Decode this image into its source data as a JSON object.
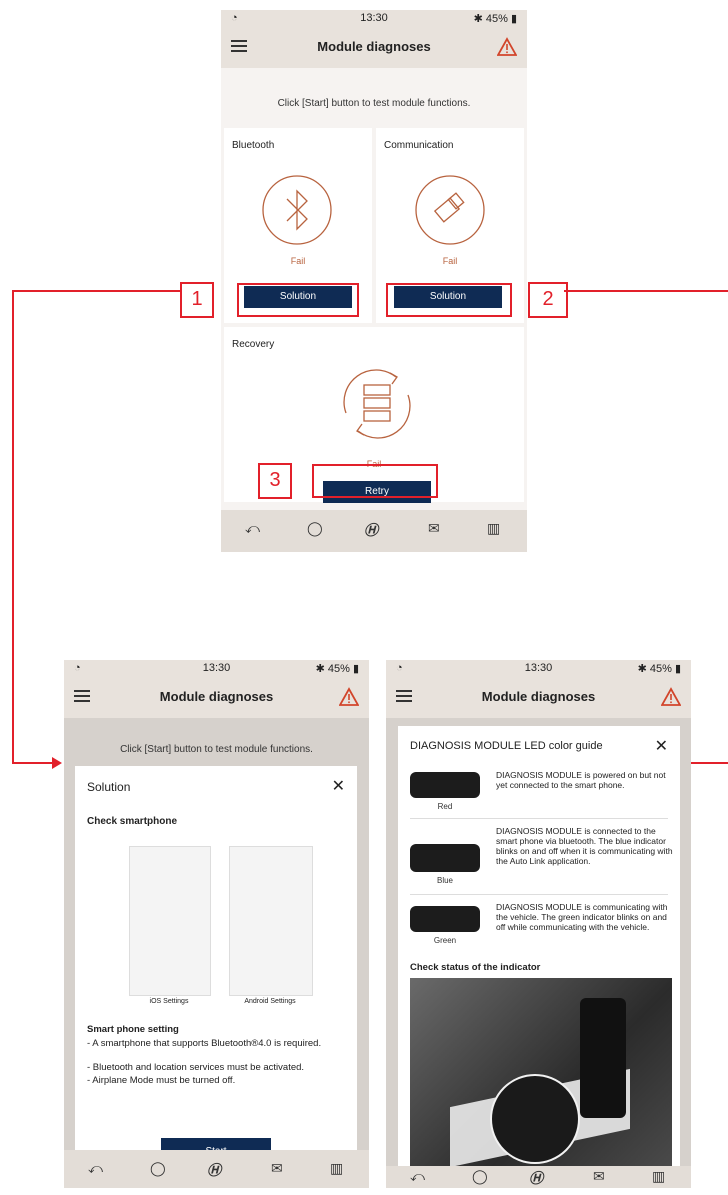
{
  "status": {
    "time": "13:30",
    "battery": "45%",
    "bt": "✱"
  },
  "app": {
    "title": "Module diagnoses"
  },
  "main": {
    "instruction": "Click [Start] button to test module functions.",
    "bluetooth": {
      "title": "Bluetooth",
      "status": "Fail",
      "button": "Solution"
    },
    "communication": {
      "title": "Communication",
      "status": "Fail",
      "button": "Solution"
    },
    "recovery": {
      "title": "Recovery",
      "status": "Fail",
      "button": "Retry"
    }
  },
  "callouts": [
    "1",
    "2",
    "3"
  ],
  "solution_screen": {
    "instruction": "Click [Start] button to test module functions.",
    "sheet_title": "Solution",
    "check_heading": "Check smartphone",
    "ios_caption": "iOS Settings",
    "android_caption": "Android Settings",
    "setting_heading": "Smart phone setting",
    "lines": [
      "- A smartphone that supports Bluetooth®4.0 is required.",
      "- Bluetooth and location services must be activated.",
      "- Airplane Mode must be turned off."
    ],
    "start_button": "Start"
  },
  "led_screen": {
    "sheet_title": "DIAGNOSIS MODULE LED color guide",
    "items": [
      {
        "label": "Red",
        "text": "DIAGNOSIS MODULE is powered on but not yet connected to the smart phone."
      },
      {
        "label": "Blue",
        "text": "DIAGNOSIS MODULE is connected to the smart phone via bluetooth. The blue indicator blinks on and off when it is communicating with the Auto Link application."
      },
      {
        "label": "Green",
        "text": "DIAGNOSIS MODULE is communicating with the vehicle. The green indicator blinks on and off while communicating with the vehicle."
      }
    ],
    "check_heading": "Check status of the indicator"
  },
  "colors": {
    "accent": "#0f2b54",
    "fail": "#b8633f",
    "callout": "#e2202a"
  },
  "nav_icons": [
    "back-icon",
    "location-icon",
    "hyundai-logo-icon",
    "mail-icon",
    "map-icon"
  ]
}
